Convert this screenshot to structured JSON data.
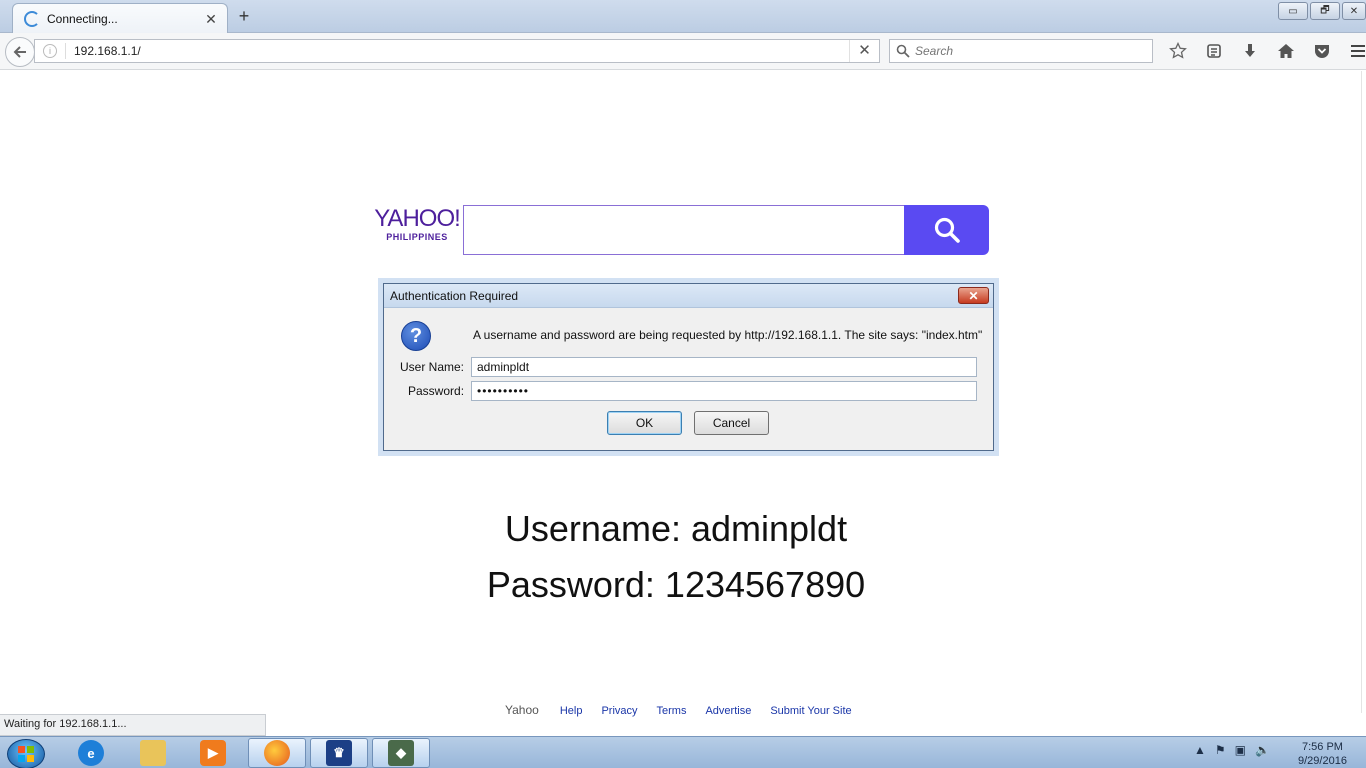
{
  "browser": {
    "tab_title": "Connecting...",
    "tab_close": "✕",
    "new_tab": "+",
    "window_controls": [
      "▭",
      "🗗",
      "✕"
    ],
    "url": "192.168.1.1/",
    "url_stop": "✕",
    "search_placeholder": "Search",
    "nav_icons": [
      "bookmark-star-icon",
      "reading-list-icon",
      "downloads-icon",
      "home-icon",
      "pocket-icon",
      "menu-icon"
    ],
    "status_text": "Waiting for 192.168.1.1..."
  },
  "page": {
    "logo_word": "YAHOO!",
    "logo_sub": "PHILIPPINES",
    "search_value": "",
    "username_line": "Username: adminpldt",
    "password_line": "Password: 1234567890",
    "footer": {
      "brand": "Yahoo",
      "links": [
        "Help",
        "Privacy",
        "Terms",
        "Advertise",
        "Submit Your Site"
      ]
    }
  },
  "dialog": {
    "title": "Authentication Required",
    "close": "✕",
    "icon_glyph": "?",
    "message": "A username and password are being requested by http://192.168.1.1. The site says: \"index.htm\"",
    "username_label": "User Name:",
    "username_value": "adminpldt",
    "password_label": "Password:",
    "password_value": "••••••••••",
    "ok_label": "OK",
    "cancel_label": "Cancel"
  },
  "taskbar": {
    "apps": [
      "internet-explorer",
      "file-explorer",
      "media-player",
      "firefox",
      "crown-app",
      "app"
    ],
    "active_app": "firefox",
    "clock_time": "7:56 PM",
    "clock_date": "9/29/2016"
  },
  "colors": {
    "yahoo_purple": "#4d1f9c",
    "yahoo_search_button": "#5a4af2",
    "link_blue": "#1a36a8"
  }
}
